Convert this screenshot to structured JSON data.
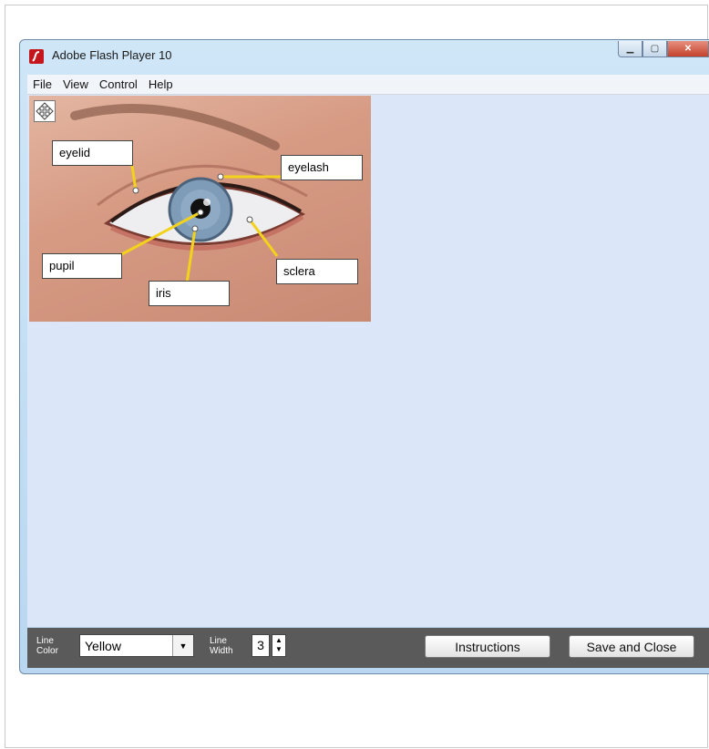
{
  "window": {
    "title": "Adobe Flash Player 10"
  },
  "menu": [
    "File",
    "View",
    "Control",
    "Help"
  ],
  "labels": {
    "eyelid": "eyelid",
    "eyelash": "eyelash",
    "pupil": "pupil",
    "iris": "iris",
    "sclera": "sclera"
  },
  "toolbar": {
    "line_color_label_1": "Line",
    "line_color_label_2": "Color",
    "line_color_value": "Yellow",
    "line_width_label_1": "Line",
    "line_width_label_2": "Width",
    "line_width_value": "3",
    "instructions_button": "Instructions",
    "save_close_button": "Save and Close"
  },
  "colors": {
    "leader_line": "#f3d21b",
    "stage_bg": "#dce6f9"
  }
}
